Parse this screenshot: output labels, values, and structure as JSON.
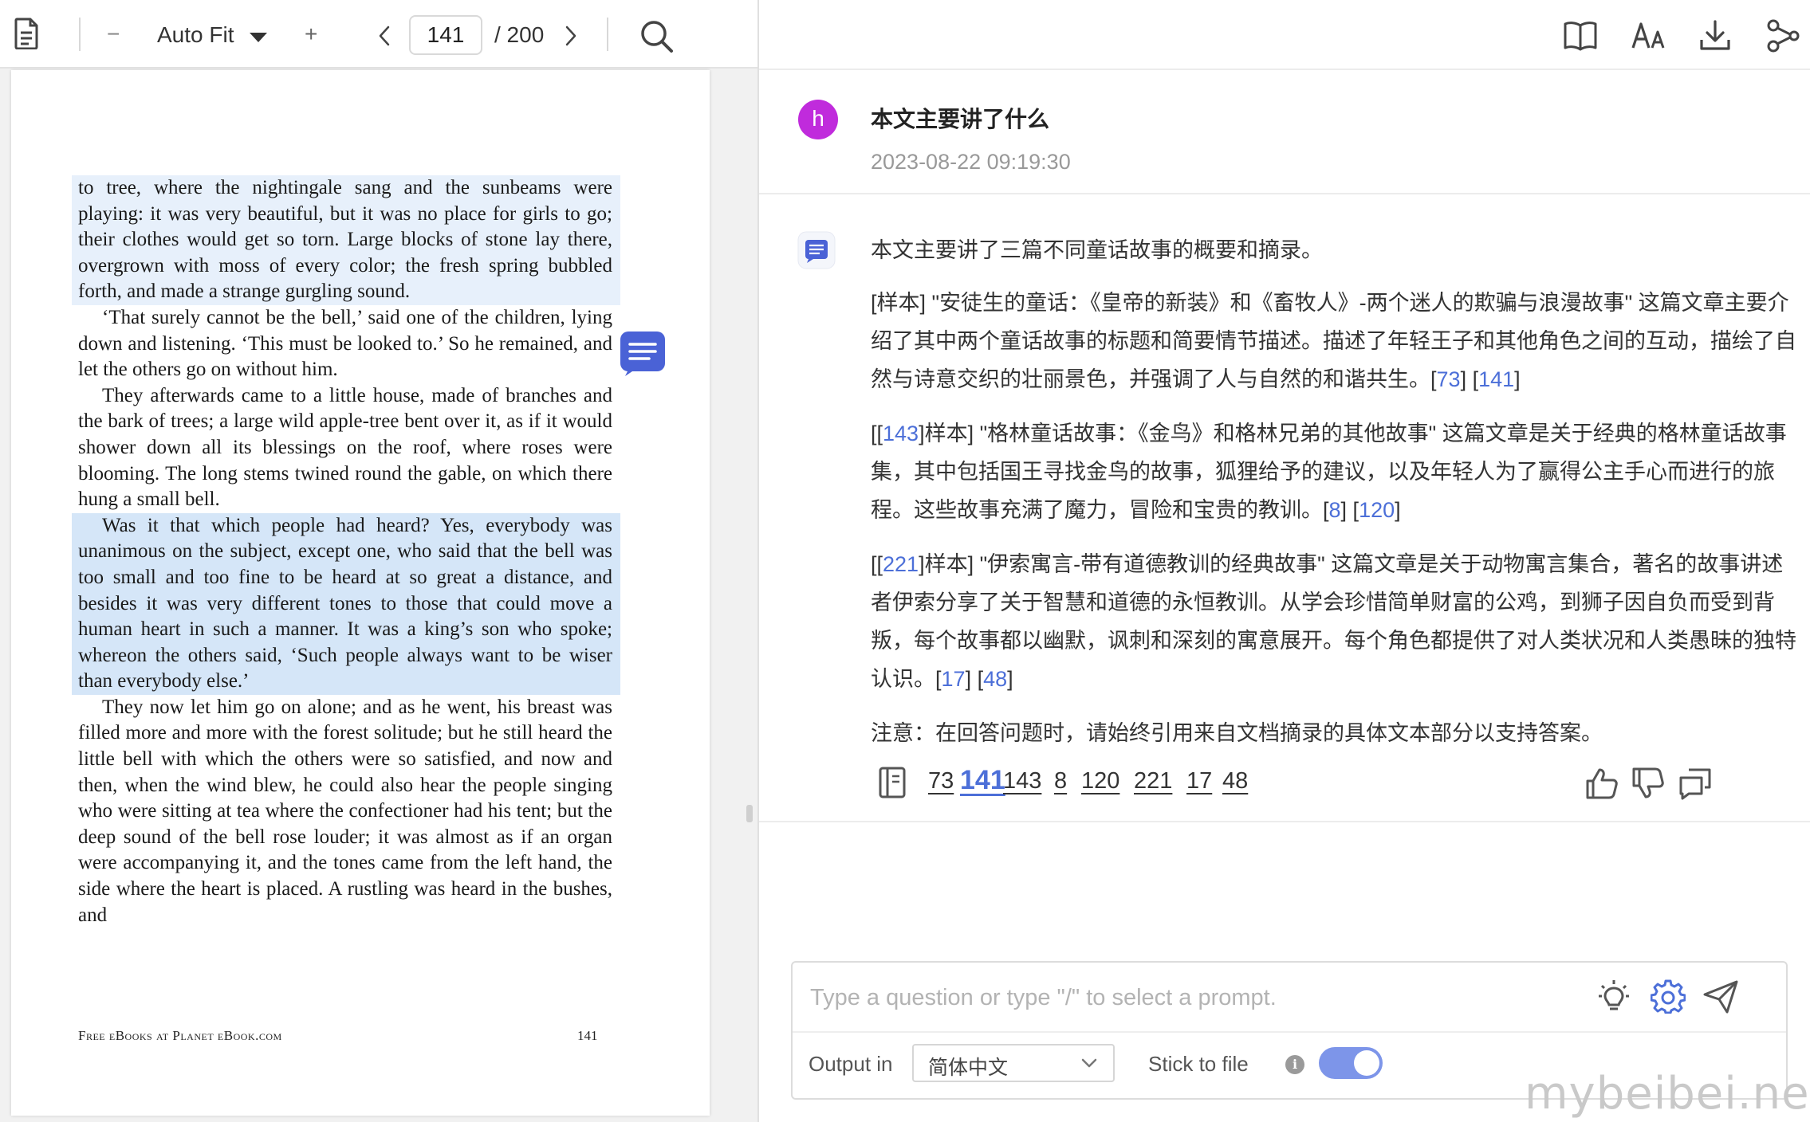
{
  "viewer": {
    "zoom_label": "Auto Fit",
    "page_current": "141",
    "page_total": "/ 200",
    "minus_glyph": "−",
    "plus_glyph": "+",
    "icons": [
      "document-icon",
      "zoom-out-icon",
      "dropdown-caret-icon",
      "zoom-in-icon",
      "prev-page-icon",
      "next-page-icon",
      "search-icon",
      "note-badge-icon"
    ]
  },
  "page": {
    "paragraphs": [
      {
        "text": "to tree, where the nightingale sang and the sunbeams were playing: it was very beautiful, but it was no place for girls to go; their clothes would get so torn. Large blocks of stone lay there, overgrown with moss of every color; the fresh spring bubbled forth, and made a strange gurgling sound.",
        "highlight": "light",
        "indent": false
      },
      {
        "text": "‘That surely cannot be the bell,’ said one of the children, lying down and listening. ‘This must be looked to.’ So he remained, and let the others go on without him.",
        "highlight": "none",
        "indent": true
      },
      {
        "text": "They afterwards came to a little house, made of branches and the bark of trees; a large wild apple-tree bent over it, as if it would shower down all its blessings on the roof, where roses were blooming. The long stems twined round the gable, on which there hung a small bell.",
        "highlight": "none",
        "indent": true
      },
      {
        "text": "Was it that which people had heard? Yes, everybody was unanimous on the subject, except one, who said that the bell was too small and too fine to be heard at so great a distance, and besides it was very different tones to those that could move a human heart in such a manner. It was a king’s son who spoke; whereon the others said, ‘Such people always want to be wiser than everybody else.’",
        "highlight": "strong",
        "indent": true
      },
      {
        "text": "They now let him go on alone; and as he went, his breast was filled more and more with the forest solitude; but he still heard the little bell with which the others were so satisfied, and now and then, when the wind blew, he could also hear the people singing who were sitting at tea where the confectioner had his tent; but the deep sound of the bell rose louder; it was almost as if an organ were accompanying it, and the tones came from the left hand, the side where the heart is placed. A rustling was heard in the bushes, and",
        "highlight": "none",
        "indent": true
      }
    ],
    "footer_left": "Free eBooks at Planet eBook.com",
    "footer_page": "141"
  },
  "chat": {
    "toolbar_icons": [
      "book-icon",
      "font-size-icon",
      "download-icon",
      "share-icon"
    ],
    "user_avatar_letter": "h",
    "question": "本文主要讲了什么",
    "question_time": "2023-08-22 09:19:30",
    "answer": {
      "intro": "本文主要讲了三篇不同童话故事的概要和摘录。",
      "p1_text": "[样本] \"安徒生的童话：《皇帝的新装》和《畜牧人》-两个迷人的欺骗与浪漫故事\" 这篇文章主要介绍了其中两个童话故事的标题和简要情节描述。描述了年轻王子和其他角色之间的互动，描绘了自然与诗意交织的壮丽景色，并强调了人与自然的和谐共生。",
      "p1_cite_a": "73",
      "p1_cite_b": "141",
      "p2_lead": "[[",
      "p2_cite_lead": "143",
      "p2_text": "]样本] \"格林童话故事：《金鸟》和格林兄弟的其他故事\" 这篇文章是关于经典的格林童话故事集，其中包括国王寻找金鸟的故事，狐狸给予的建议，以及年轻人为了赢得公主手心而进行的旅程。这些故事充满了魔力，冒险和宝贵的教训。",
      "p2_cite_a": "8",
      "p2_cite_b": "120",
      "p3_lead": "[[",
      "p3_cite_lead": "221",
      "p3_text": "]样本] \"伊索寓言-带有道德教训的经典故事\" 这篇文章是关于动物寓言集合，著名的故事讲述者伊索分享了关于智慧和道德的永恒教训。从学会珍惜简单财富的公鸡，到狮子因自负而受到背叛，每个故事都以幽默，讽刺和深刻的寓意展开。每个角色都提供了对人类状况和人类愚昧的独特认识。",
      "p3_cite_a": "17",
      "p3_cite_b": "48",
      "note": "注意：在回答问题时，请始终引用来自文档摘录的具体文本部分以支持答案。"
    },
    "references": [
      "73",
      "141",
      "143",
      "8",
      "120",
      "221",
      "17",
      "48"
    ],
    "active_reference": "141",
    "feedback_icons": [
      "thumbs-up-icon",
      "thumbs-down-icon",
      "copy-icon"
    ],
    "composer": {
      "placeholder": "Type a question or type \"/\" to select a prompt.",
      "value": "",
      "output_label": "Output in",
      "language": "简体中文",
      "stick_label": "Stick to file",
      "info_glyph": "i",
      "stick_enabled": true
    },
    "accent_color": "#4c6fd8",
    "avatar_color": "#c02bdc"
  },
  "watermark": "mybeibei.net"
}
